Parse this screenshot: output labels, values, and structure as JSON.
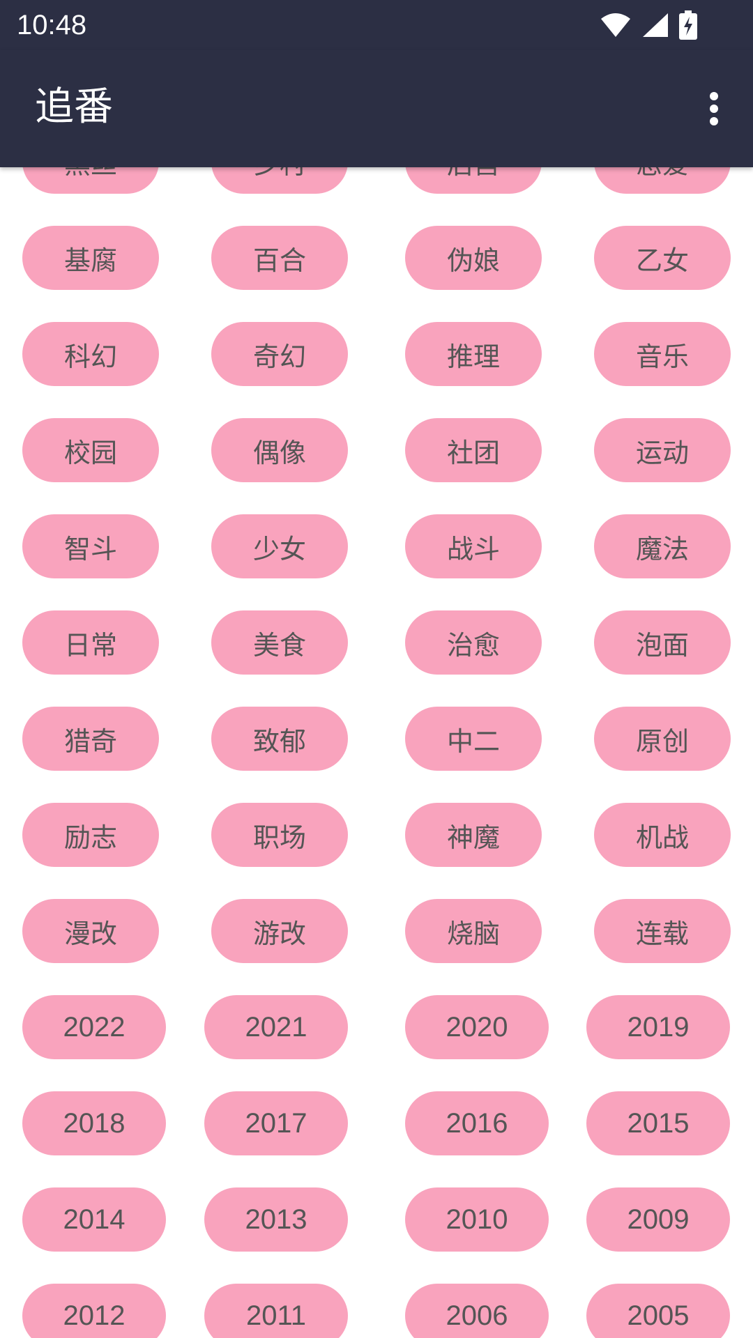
{
  "status_bar": {
    "time": "10:48"
  },
  "app_bar": {
    "title": "追番"
  },
  "tags": {
    "partial_row": [
      "黑丝",
      "乡村",
      "后宫",
      "恋爱"
    ],
    "rows": [
      [
        "基腐",
        "百合",
        "伪娘",
        "乙女"
      ],
      [
        "科幻",
        "奇幻",
        "推理",
        "音乐"
      ],
      [
        "校园",
        "偶像",
        "社团",
        "运动"
      ],
      [
        "智斗",
        "少女",
        "战斗",
        "魔法"
      ],
      [
        "日常",
        "美食",
        "治愈",
        "泡面"
      ],
      [
        "猎奇",
        "致郁",
        "中二",
        "原创"
      ],
      [
        "励志",
        "职场",
        "神魔",
        "机战"
      ],
      [
        "漫改",
        "游改",
        "烧脑",
        "连载"
      ]
    ],
    "year_rows": [
      [
        "2022",
        "2021",
        "2020",
        "2019"
      ],
      [
        "2018",
        "2017",
        "2016",
        "2015"
      ],
      [
        "2014",
        "2013",
        "2010",
        "2009"
      ],
      [
        "2012",
        "2011",
        "2006",
        "2005"
      ]
    ]
  },
  "colors": {
    "bar": "#2c2f44",
    "chip": "#f9a3bd",
    "chip_text": "#555555"
  }
}
